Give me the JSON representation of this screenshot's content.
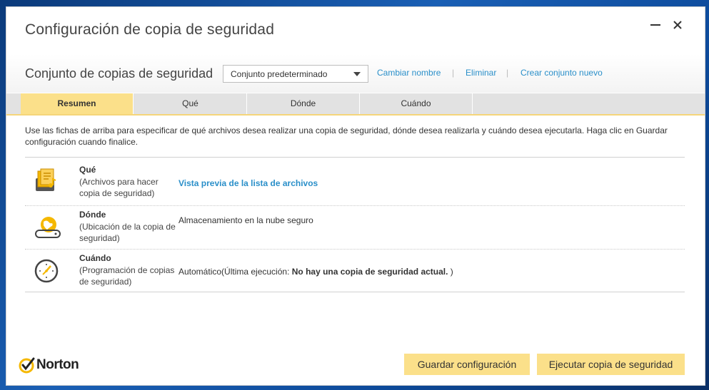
{
  "window": {
    "title": "Configuración de copia de seguridad"
  },
  "backup_set": {
    "label": "Conjunto de copias de seguridad",
    "selected": "Conjunto predeterminado",
    "links": [
      "Cambiar nombre",
      "Eliminar",
      "Crear conjunto nuevo"
    ],
    "separator": "|"
  },
  "tabs": [
    {
      "label": "Resumen",
      "active": true
    },
    {
      "label": "Qué",
      "active": false
    },
    {
      "label": "Dónde",
      "active": false
    },
    {
      "label": "Cuándo",
      "active": false
    }
  ],
  "intro_text": "Use las fichas de arriba para especificar de qué archivos desea realizar una copia de seguridad, dónde desea realizarla y cuándo desea ejecutarla. Haga clic en Guardar configuración cuando finalice.",
  "rows": {
    "what": {
      "icon": "files-icon",
      "title": "Qué",
      "desc": "(Archivos para hacer copia de seguridad)",
      "value": "Vista previa de la lista de archivos"
    },
    "where": {
      "icon": "cloud-drive-icon",
      "title": "Dónde",
      "desc": "(Ubicación de la copia de seguridad)",
      "value": "Almacenamiento en la nube seguro"
    },
    "when": {
      "icon": "clock-icon",
      "title": "Cuándo",
      "desc": "(Programación de copias de seguridad)",
      "value_prefix": "Automático(Última ejecución: ",
      "value_bold": "No hay una copia de seguridad actual.",
      "value_suffix": " )"
    }
  },
  "brand": {
    "name": "Norton",
    "accent": "#fbe08a",
    "link_color": "#2a8fc9",
    "logo_check_color": "#f5b800"
  },
  "actions": {
    "save": "Guardar configuración",
    "run": "Ejecutar copia de seguridad"
  }
}
